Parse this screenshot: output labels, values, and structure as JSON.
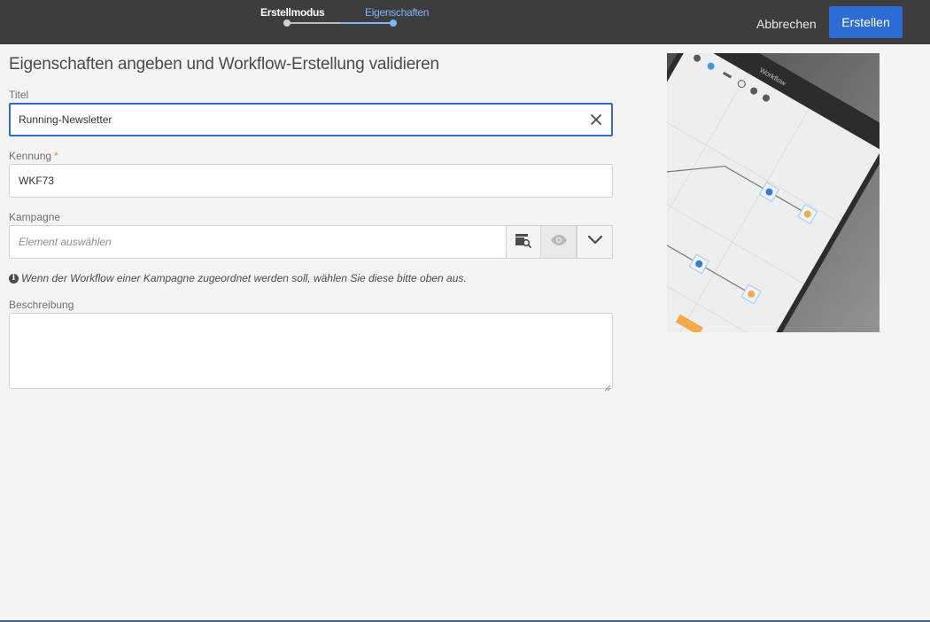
{
  "stepper": {
    "steps": [
      {
        "label": "Erstellmodus",
        "state": "done"
      },
      {
        "label": "Eigenschaften",
        "state": "active"
      }
    ]
  },
  "toolbar": {
    "cancel_label": "Abbrechen",
    "create_label": "Erstellen"
  },
  "form": {
    "title": "Eigenschaften angeben und Workflow-Erstellung validieren",
    "title_field": {
      "label": "Titel",
      "value": "Running-Newsletter"
    },
    "id_field": {
      "label": "Kennung",
      "required_mark": "*",
      "value": "WKF73"
    },
    "campaign_field": {
      "label": "Kampagne",
      "placeholder": "Element auswählen"
    },
    "hint": "Wenn der Workflow einer Kampagne zugeordnet werden soll, wählen Sie diese bitte oben aus.",
    "description_field": {
      "label": "Beschreibung",
      "value": ""
    }
  },
  "preview": {
    "window_title": "Workflow"
  },
  "colors": {
    "topbar": "#3d3d3d",
    "accent": "#2d6cd4",
    "active_step": "#7fb4ff",
    "required": "#e68619"
  },
  "icons": [
    "close-icon",
    "folder-search-icon",
    "eye-icon",
    "chevron-down-icon",
    "info-icon"
  ]
}
